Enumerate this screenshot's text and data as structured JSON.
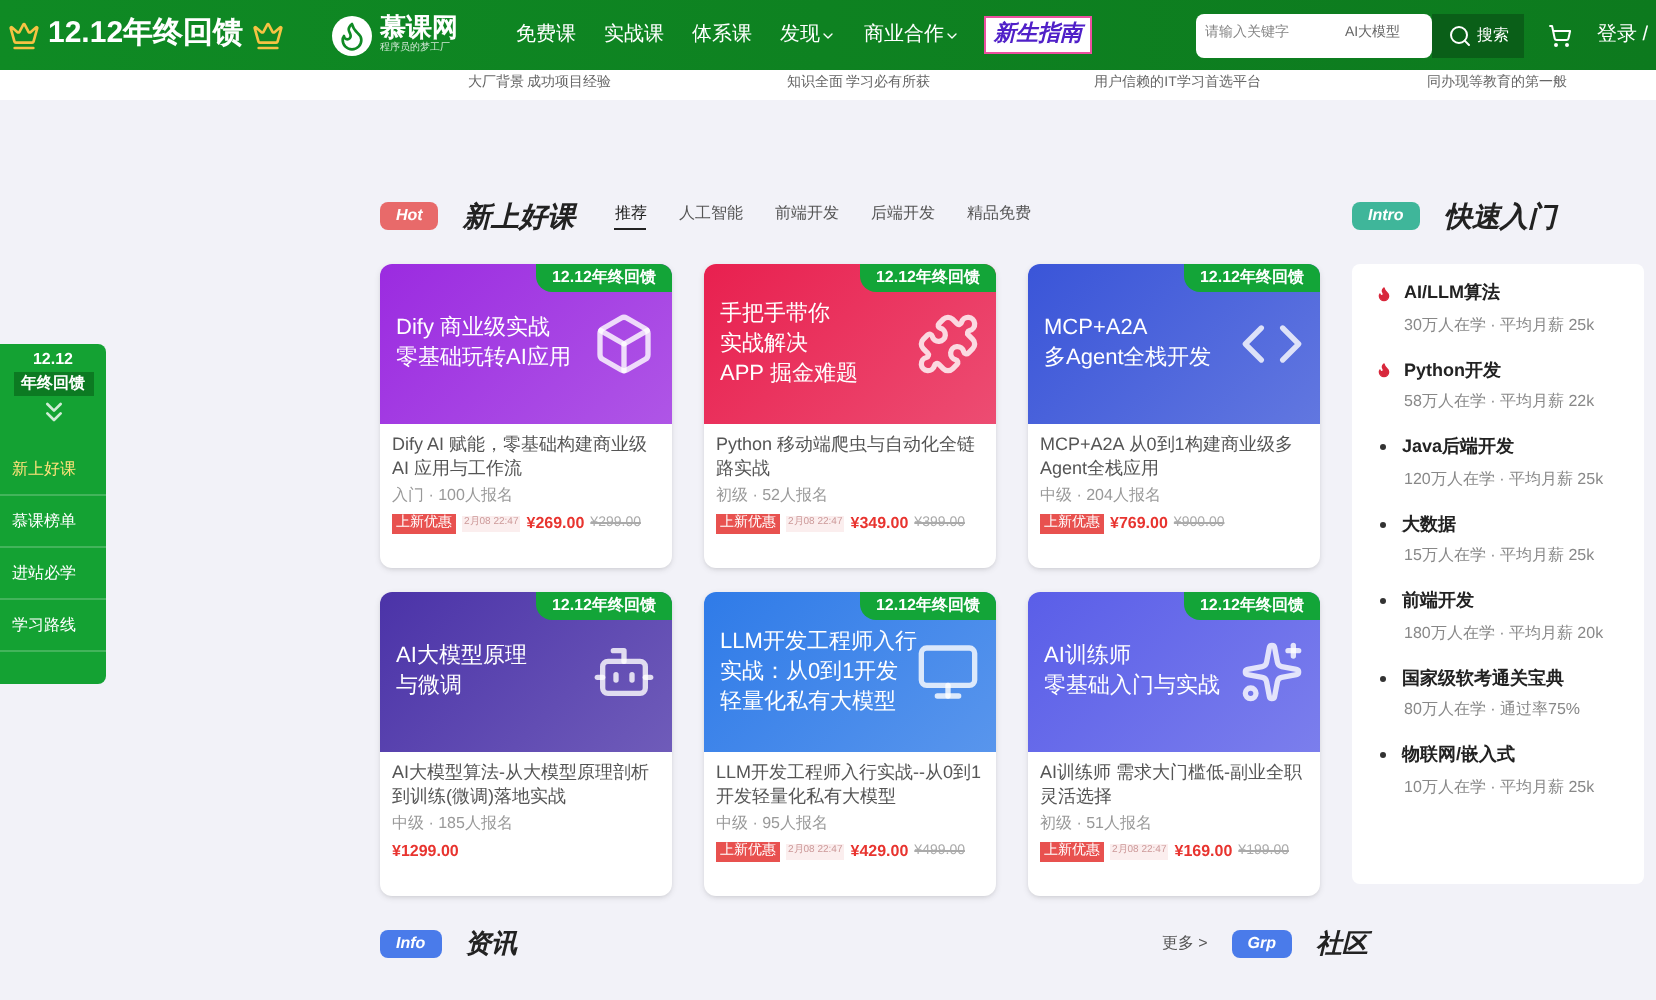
{
  "header": {
    "promo_title": "12.12年终回馈",
    "logo_name": "慕课网",
    "logo_slogan": "程序员的梦工厂",
    "nav": [
      {
        "label": "免费课",
        "has_menu": false
      },
      {
        "label": "实战课",
        "has_menu": false
      },
      {
        "label": "体系课",
        "has_menu": false
      },
      {
        "label": "发现",
        "has_menu": true
      },
      {
        "label": "商业合作",
        "has_menu": true
      }
    ],
    "guide_badge": "新生指南",
    "search": {
      "placeholder": "请输入关键字",
      "tag": "AI大模型",
      "button": "搜索"
    },
    "login": "登录 /"
  },
  "feature_strip": [
    "大厂背景 成功项目经验",
    "知识全面 学习必有所获",
    "用户信赖的IT学习首选平台",
    "同办现等教育的第一般"
  ],
  "side_promo": {
    "year": "12.12",
    "title": "年终回馈",
    "items": [
      {
        "label": "新上好课",
        "selected": true
      },
      {
        "label": "慕课榜单",
        "selected": false
      },
      {
        "label": "进站必学",
        "selected": false
      },
      {
        "label": "学习路线",
        "selected": false
      }
    ]
  },
  "new_courses": {
    "badge": "Hot",
    "title": "新上好课",
    "tabs": [
      {
        "label": "推荐",
        "selected": true
      },
      {
        "label": "人工智能",
        "selected": false
      },
      {
        "label": "前端开发",
        "selected": false
      },
      {
        "label": "后端开发",
        "selected": false
      },
      {
        "label": "精品免费",
        "selected": false
      }
    ],
    "courses": [
      {
        "ribbon": "12.12年终回馈",
        "banner_lines": [
          "Dify 商业级实战",
          "零基础玩转AI应用"
        ],
        "color": "#9b2be0",
        "title": "Dify AI 赋能，零基础构建商业级 AI 应用与工作流",
        "meta": "入门 · 100人报名",
        "tag": "上新优惠",
        "date": "2月08 22:47",
        "price": "¥269.00",
        "old_price": "¥299.00"
      },
      {
        "ribbon": "12.12年终回馈",
        "banner_lines": [
          "手把手带你",
          "实战解决",
          "APP 掘金难题"
        ],
        "color": "#e8204f",
        "title": "Python 移动端爬虫与自动化全链路实战",
        "meta": "初级 · 52人报名",
        "tag": "上新优惠",
        "date": "2月08 22:47",
        "price": "¥349.00",
        "old_price": "¥399.00"
      },
      {
        "ribbon": "12.12年终回馈",
        "banner_lines": [
          "MCP+A2A",
          "多Agent全栈开发"
        ],
        "color": "#3a55d8",
        "title": "MCP+A2A 从0到1构建商业级多Agent全栈应用",
        "meta": "中级 · 204人报名",
        "tag": "上新优惠",
        "price": "¥769.00",
        "old_price": "¥900.00"
      },
      {
        "ribbon": "12.12年终回馈",
        "banner_lines": [
          "AI大模型原理",
          "与微调"
        ],
        "color": "#4b33a8",
        "title": "AI大模型算法-从大模型原理剖析到训练(微调)落地实战",
        "meta": "中级 · 185人报名",
        "price": "¥1299.00"
      },
      {
        "ribbon": "12.12年终回馈",
        "banner_lines": [
          "LLM开发工程师入行",
          "实战：从0到1开发",
          "轻量化私有大模型"
        ],
        "color": "#2f7be8",
        "title": "LLM开发工程师入行实战--从0到1开发轻量化私有大模型",
        "meta": "中级 · 95人报名",
        "tag": "上新优惠",
        "date": "2月08 22:47",
        "price": "¥429.00",
        "old_price": "¥499.00"
      },
      {
        "ribbon": "12.12年终回馈",
        "banner_lines": [
          "AI训练师",
          "零基础入门与实战"
        ],
        "color": "#5a5ee8",
        "title": "AI训练师 需求大门槛低-副业全职灵活选择",
        "meta": "初级 · 51人报名",
        "tag": "上新优惠",
        "date": "2月08 22:47",
        "price": "¥169.00",
        "old_price": "¥199.00"
      }
    ]
  },
  "quick_start": {
    "badge": "Intro",
    "title": "快速入门",
    "items": [
      {
        "title": "AI/LLM算法",
        "stats": "30万人在学 · 平均月薪 25k",
        "hot": true
      },
      {
        "title": "Python开发",
        "stats": "58万人在学 · 平均月薪 22k",
        "hot": true
      },
      {
        "title": "Java后端开发",
        "stats": "120万人在学 · 平均月薪 25k",
        "hot": false
      },
      {
        "title": "大数据",
        "stats": "15万人在学 · 平均月薪 25k",
        "hot": false
      },
      {
        "title": "前端开发",
        "stats": "180万人在学 · 平均月薪 20k",
        "hot": false
      },
      {
        "title": "国家级软考通关宝典",
        "stats": "80万人在学 · 通过率75%",
        "hot": false
      },
      {
        "title": "物联网/嵌入式",
        "stats": "10万人在学 · 平均月薪 25k",
        "hot": false
      }
    ]
  },
  "news": {
    "badge": "Info",
    "title": "资讯",
    "more": "更多 >"
  },
  "community": {
    "badge": "Grp",
    "title": "社区"
  }
}
